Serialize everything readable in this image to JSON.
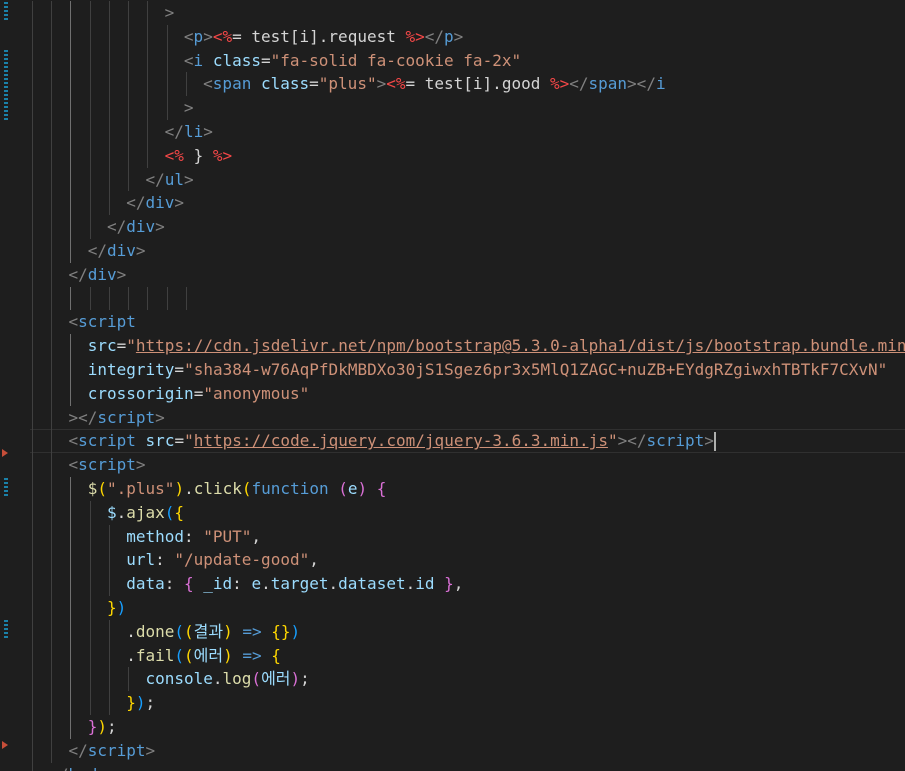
{
  "editor": {
    "theme": "dark",
    "colors": {
      "background": "#1e1e1e",
      "tag": "#569cd6",
      "attribute": "#9cdcfe",
      "string": "#ce9178",
      "function": "#dcdcaa",
      "bracket_gold": "#ffd700",
      "bracket_orchid": "#da70d6",
      "bracket_blue": "#179fff"
    },
    "lines": [
      {
        "tokens": [
          {
            "t": ">",
            "c": "pun"
          }
        ]
      },
      {
        "tokens": [
          {
            "t": "<",
            "c": "pun"
          },
          {
            "t": "p",
            "c": "tag"
          },
          {
            "t": ">",
            "c": "pun"
          },
          {
            "t": "<%",
            "c": "ejs"
          },
          {
            "t": "= test[i].request ",
            "c": "txt"
          },
          {
            "t": "%>",
            "c": "ejs"
          },
          {
            "t": "</",
            "c": "pun"
          },
          {
            "t": "p",
            "c": "tag"
          },
          {
            "t": ">",
            "c": "pun"
          }
        ]
      },
      {
        "tokens": [
          {
            "t": "<",
            "c": "pun"
          },
          {
            "t": "i",
            "c": "tag"
          },
          {
            "t": " ",
            "c": "txt"
          },
          {
            "t": "class",
            "c": "attr"
          },
          {
            "t": "=",
            "c": "txt"
          },
          {
            "t": "\"fa-solid fa-cookie fa-2x\"",
            "c": "str"
          }
        ]
      },
      {
        "tokens": [
          {
            "t": "<",
            "c": "pun"
          },
          {
            "t": "span",
            "c": "tag"
          },
          {
            "t": " ",
            "c": "txt"
          },
          {
            "t": "class",
            "c": "attr"
          },
          {
            "t": "=",
            "c": "txt"
          },
          {
            "t": "\"plus\"",
            "c": "str"
          },
          {
            "t": ">",
            "c": "pun"
          },
          {
            "t": "<%",
            "c": "ejs"
          },
          {
            "t": "= test[i].good ",
            "c": "txt"
          },
          {
            "t": "%>",
            "c": "ejs"
          },
          {
            "t": "</",
            "c": "pun"
          },
          {
            "t": "span",
            "c": "tag"
          },
          {
            "t": "></",
            "c": "pun"
          },
          {
            "t": "i",
            "c": "tag"
          }
        ]
      },
      {
        "tokens": [
          {
            "t": ">",
            "c": "pun"
          }
        ]
      },
      {
        "tokens": [
          {
            "t": "</",
            "c": "pun"
          },
          {
            "t": "li",
            "c": "tag"
          },
          {
            "t": ">",
            "c": "pun"
          }
        ]
      },
      {
        "tokens": [
          {
            "t": "<%",
            "c": "ejs"
          },
          {
            "t": " } ",
            "c": "txt"
          },
          {
            "t": "%>",
            "c": "ejs"
          }
        ]
      },
      {
        "tokens": [
          {
            "t": "</",
            "c": "pun"
          },
          {
            "t": "ul",
            "c": "tag"
          },
          {
            "t": ">",
            "c": "pun"
          }
        ]
      },
      {
        "tokens": [
          {
            "t": "</",
            "c": "pun"
          },
          {
            "t": "div",
            "c": "tag"
          },
          {
            "t": ">",
            "c": "pun"
          }
        ]
      },
      {
        "tokens": [
          {
            "t": "</",
            "c": "pun"
          },
          {
            "t": "div",
            "c": "tag"
          },
          {
            "t": ">",
            "c": "pun"
          }
        ]
      },
      {
        "tokens": [
          {
            "t": "</",
            "c": "pun"
          },
          {
            "t": "div",
            "c": "tag"
          },
          {
            "t": ">",
            "c": "pun"
          }
        ]
      },
      {
        "tokens": [
          {
            "t": "</",
            "c": "pun"
          },
          {
            "t": "div",
            "c": "tag"
          },
          {
            "t": ">",
            "c": "pun"
          }
        ]
      },
      {
        "tokens": []
      },
      {
        "tokens": [
          {
            "t": "<",
            "c": "pun"
          },
          {
            "t": "script",
            "c": "tag"
          }
        ]
      },
      {
        "tokens": [
          {
            "t": "src",
            "c": "attr"
          },
          {
            "t": "=",
            "c": "txt"
          },
          {
            "t": "\"",
            "c": "str"
          },
          {
            "t": "https://cdn.jsdelivr.net/npm/bootstrap@5.3.0-alpha1/dist/js/bootstrap.bundle.min",
            "c": "url"
          }
        ]
      },
      {
        "tokens": [
          {
            "t": "integrity",
            "c": "attr"
          },
          {
            "t": "=",
            "c": "txt"
          },
          {
            "t": "\"sha384-w76AqPfDkMBDXo30jS1Sgez6pr3x5MlQ1ZAGC+nuZB+EYdgRZgiwxhTBTkF7CXvN\"",
            "c": "str"
          }
        ]
      },
      {
        "tokens": [
          {
            "t": "crossorigin",
            "c": "attr"
          },
          {
            "t": "=",
            "c": "txt"
          },
          {
            "t": "\"anonymous\"",
            "c": "str"
          }
        ]
      },
      {
        "tokens": [
          {
            "t": "></",
            "c": "pun"
          },
          {
            "t": "script",
            "c": "tag"
          },
          {
            "t": ">",
            "c": "pun"
          }
        ]
      },
      {
        "tokens": [
          {
            "t": "<",
            "c": "pun"
          },
          {
            "t": "script",
            "c": "tag"
          },
          {
            "t": " ",
            "c": "txt"
          },
          {
            "t": "src",
            "c": "attr"
          },
          {
            "t": "=",
            "c": "txt"
          },
          {
            "t": "\"",
            "c": "str"
          },
          {
            "t": "https://code.jquery.com/jquery-3.6.3.min.js",
            "c": "url"
          },
          {
            "t": "\"",
            "c": "str"
          },
          {
            "t": "></",
            "c": "pun"
          },
          {
            "t": "script",
            "c": "tag"
          },
          {
            "t": ">",
            "c": "pun"
          }
        ]
      },
      {
        "tokens": [
          {
            "t": "<",
            "c": "pun"
          },
          {
            "t": "script",
            "c": "tag"
          },
          {
            "t": ">",
            "c": "pun"
          }
        ]
      },
      {
        "tokens": [
          {
            "t": "$",
            "c": "fn"
          },
          {
            "t": "(",
            "c": "b1"
          },
          {
            "t": "\".plus\"",
            "c": "str"
          },
          {
            "t": ")",
            "c": "b1"
          },
          {
            "t": ".",
            "c": "txt"
          },
          {
            "t": "click",
            "c": "fn"
          },
          {
            "t": "(",
            "c": "b1"
          },
          {
            "t": "function",
            "c": "kw"
          },
          {
            "t": " ",
            "c": "txt"
          },
          {
            "t": "(",
            "c": "b2"
          },
          {
            "t": "e",
            "c": "var"
          },
          {
            "t": ")",
            "c": "b2"
          },
          {
            "t": " ",
            "c": "txt"
          },
          {
            "t": "{",
            "c": "b2"
          }
        ]
      },
      {
        "tokens": [
          {
            "t": "$",
            "c": "var"
          },
          {
            "t": ".",
            "c": "txt"
          },
          {
            "t": "ajax",
            "c": "fn"
          },
          {
            "t": "(",
            "c": "b3"
          },
          {
            "t": "{",
            "c": "b1"
          }
        ]
      },
      {
        "tokens": [
          {
            "t": "method",
            "c": "var"
          },
          {
            "t": ": ",
            "c": "txt"
          },
          {
            "t": "\"PUT\"",
            "c": "str"
          },
          {
            "t": ",",
            "c": "txt"
          }
        ]
      },
      {
        "tokens": [
          {
            "t": "url",
            "c": "var"
          },
          {
            "t": ": ",
            "c": "txt"
          },
          {
            "t": "\"/update-good\"",
            "c": "str"
          },
          {
            "t": ",",
            "c": "txt"
          }
        ]
      },
      {
        "tokens": [
          {
            "t": "data",
            "c": "var"
          },
          {
            "t": ": ",
            "c": "txt"
          },
          {
            "t": "{",
            "c": "b2"
          },
          {
            "t": " ",
            "c": "txt"
          },
          {
            "t": "_id",
            "c": "var"
          },
          {
            "t": ": ",
            "c": "txt"
          },
          {
            "t": "e",
            "c": "var"
          },
          {
            "t": ".",
            "c": "txt"
          },
          {
            "t": "target",
            "c": "var"
          },
          {
            "t": ".",
            "c": "txt"
          },
          {
            "t": "dataset",
            "c": "var"
          },
          {
            "t": ".",
            "c": "txt"
          },
          {
            "t": "id",
            "c": "var"
          },
          {
            "t": " ",
            "c": "txt"
          },
          {
            "t": "}",
            "c": "b2"
          },
          {
            "t": ",",
            "c": "txt"
          }
        ]
      },
      {
        "tokens": [
          {
            "t": "}",
            "c": "b1"
          },
          {
            "t": ")",
            "c": "b3"
          }
        ]
      },
      {
        "tokens": [
          {
            "t": ".",
            "c": "txt"
          },
          {
            "t": "done",
            "c": "fn"
          },
          {
            "t": "(",
            "c": "b3"
          },
          {
            "t": "(",
            "c": "b1"
          },
          {
            "t": "결과",
            "c": "var"
          },
          {
            "t": ")",
            "c": "b1"
          },
          {
            "t": " ",
            "c": "txt"
          },
          {
            "t": "=>",
            "c": "kw"
          },
          {
            "t": " ",
            "c": "txt"
          },
          {
            "t": "{}",
            "c": "b1"
          },
          {
            "t": ")",
            "c": "b3"
          }
        ]
      },
      {
        "tokens": [
          {
            "t": ".",
            "c": "txt"
          },
          {
            "t": "fail",
            "c": "fn"
          },
          {
            "t": "(",
            "c": "b3"
          },
          {
            "t": "(",
            "c": "b1"
          },
          {
            "t": "에러",
            "c": "var"
          },
          {
            "t": ")",
            "c": "b1"
          },
          {
            "t": " ",
            "c": "txt"
          },
          {
            "t": "=>",
            "c": "kw"
          },
          {
            "t": " ",
            "c": "txt"
          },
          {
            "t": "{",
            "c": "b1"
          }
        ]
      },
      {
        "tokens": [
          {
            "t": "console",
            "c": "var"
          },
          {
            "t": ".",
            "c": "txt"
          },
          {
            "t": "log",
            "c": "fn"
          },
          {
            "t": "(",
            "c": "b2"
          },
          {
            "t": "에러",
            "c": "var"
          },
          {
            "t": ")",
            "c": "b2"
          },
          {
            "t": ";",
            "c": "txt"
          }
        ]
      },
      {
        "tokens": [
          {
            "t": "}",
            "c": "b1"
          },
          {
            "t": ")",
            "c": "b3"
          },
          {
            "t": ";",
            "c": "txt"
          }
        ]
      },
      {
        "tokens": [
          {
            "t": "}",
            "c": "b2"
          },
          {
            "t": ")",
            "c": "b1"
          },
          {
            "t": ";",
            "c": "txt"
          }
        ]
      },
      {
        "tokens": [
          {
            "t": "</",
            "c": "pun"
          },
          {
            "t": "script",
            "c": "tag"
          },
          {
            "t": ">",
            "c": "pun"
          }
        ]
      },
      {
        "tokens": [
          {
            "t": "</",
            "c": "pun"
          },
          {
            "t": "body",
            "c": "tag"
          },
          {
            "t": ">",
            "c": "pun"
          }
        ]
      }
    ]
  }
}
